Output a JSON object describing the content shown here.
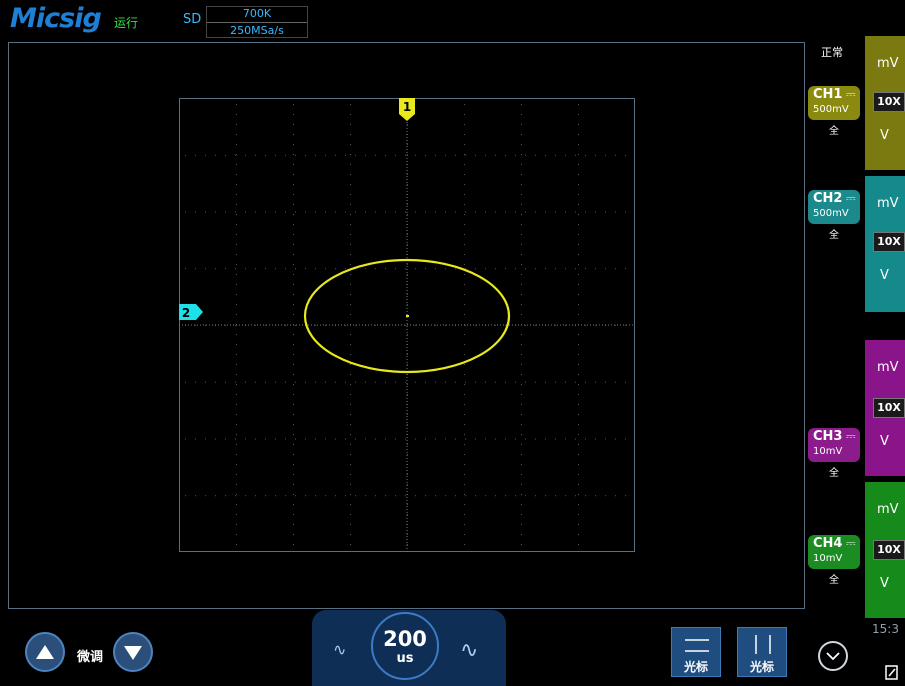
{
  "header": {
    "brand": "Micsig",
    "run_status": "运行",
    "acq_mode": "SD",
    "memory_depth": "700K",
    "sample_rate": "250MSa/s"
  },
  "trigger_status": "正常",
  "markers": {
    "ch1": "1",
    "ch2": "2"
  },
  "channels": [
    {
      "name": "CH1",
      "volts_div": "500mV",
      "coupling": "全",
      "color": "#8a8a10"
    },
    {
      "name": "CH2",
      "volts_div": "500mV",
      "coupling": "全",
      "color": "#1c8a8c"
    },
    {
      "name": "CH3",
      "volts_div": "10mV",
      "coupling": "全",
      "color": "#8c1c8c"
    },
    {
      "name": "CH4",
      "volts_div": "10mV",
      "coupling": "全",
      "color": "#1b8c22"
    }
  ],
  "side_panels": [
    {
      "top": "mV",
      "probe": "10X",
      "bottom": "V",
      "color": "#7b7a10"
    },
    {
      "top": "mV",
      "probe": "10X",
      "bottom": "V",
      "color": "#148a8c"
    },
    {
      "top": "mV",
      "probe": "10X",
      "bottom": "V",
      "color": "#8a158a"
    },
    {
      "top": "mV",
      "probe": "10X",
      "bottom": "V",
      "color": "#178a1c"
    }
  ],
  "bottom": {
    "fine_tune": "微调",
    "timebase_value": "200",
    "timebase_unit": "us",
    "cursor_h_label": "光标",
    "cursor_v_label": "光标",
    "clock": "15:3"
  },
  "trace_color": "#e8e81a"
}
